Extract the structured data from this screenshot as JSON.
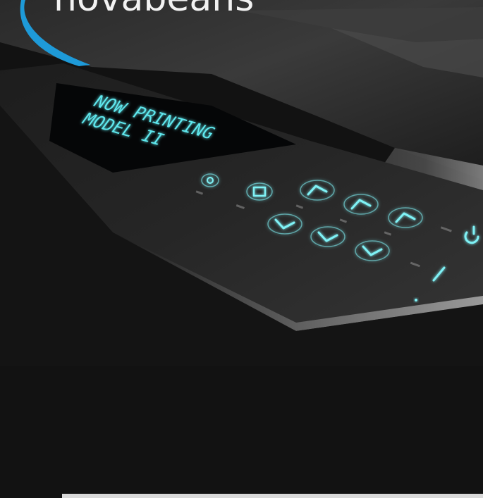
{
  "image": {
    "brand_name": "novabeans",
    "display_text": [
      "NOW PRINTING",
      "MODEL II"
    ],
    "colors": {
      "background": "#121212",
      "accent_blue": "#1e9ad8",
      "display_cyan": "#5fe8ee",
      "button_glow": "#7ff2f6"
    },
    "panel_buttons": [
      "power-symbol-icon",
      "rotate-icon",
      "chevron-up-icon",
      "chevron-up-icon",
      "chevron-up-icon",
      "chevron-down-icon",
      "chevron-down-icon",
      "chevron-down-icon",
      "power-icon",
      "line-icon"
    ]
  }
}
